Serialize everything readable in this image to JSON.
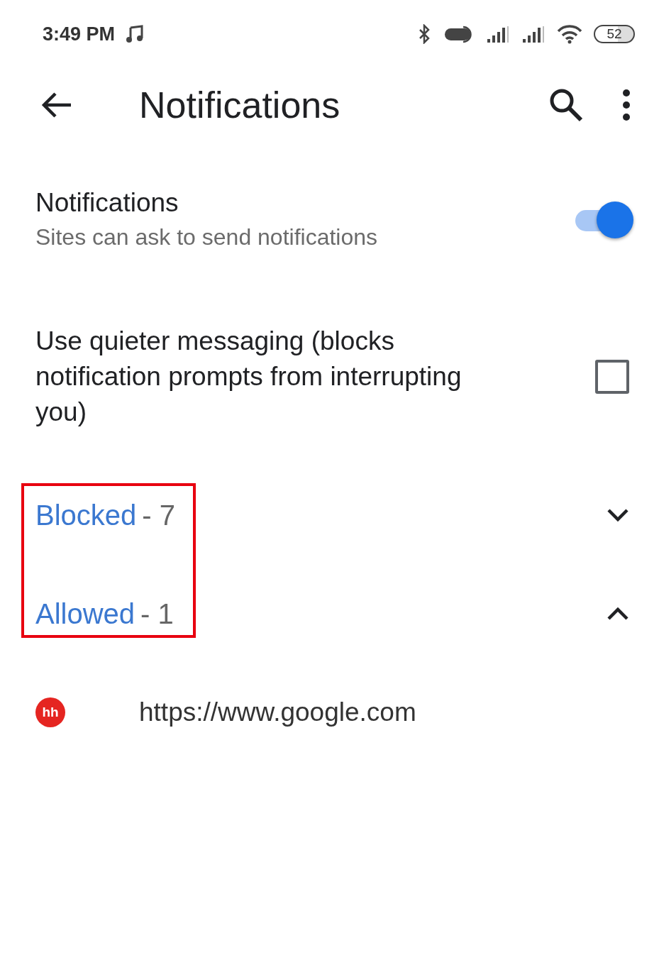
{
  "status_bar": {
    "time": "3:49 PM",
    "battery": "52"
  },
  "toolbar": {
    "title": "Notifications"
  },
  "notifications_setting": {
    "title": "Notifications",
    "subtitle": "Sites can ask to send notifications",
    "on": true
  },
  "quiet_setting": {
    "label": "Use quieter messaging (blocks notification prompts from interrupting you)",
    "checked": false
  },
  "sections_highlighted": true,
  "sections": [
    {
      "label": "Blocked",
      "count": "- 7",
      "expanded": false
    },
    {
      "label": "Allowed",
      "count": "- 1",
      "expanded": true,
      "sites": [
        {
          "favicon": "hh",
          "url": "https://www.google.com"
        }
      ]
    }
  ]
}
